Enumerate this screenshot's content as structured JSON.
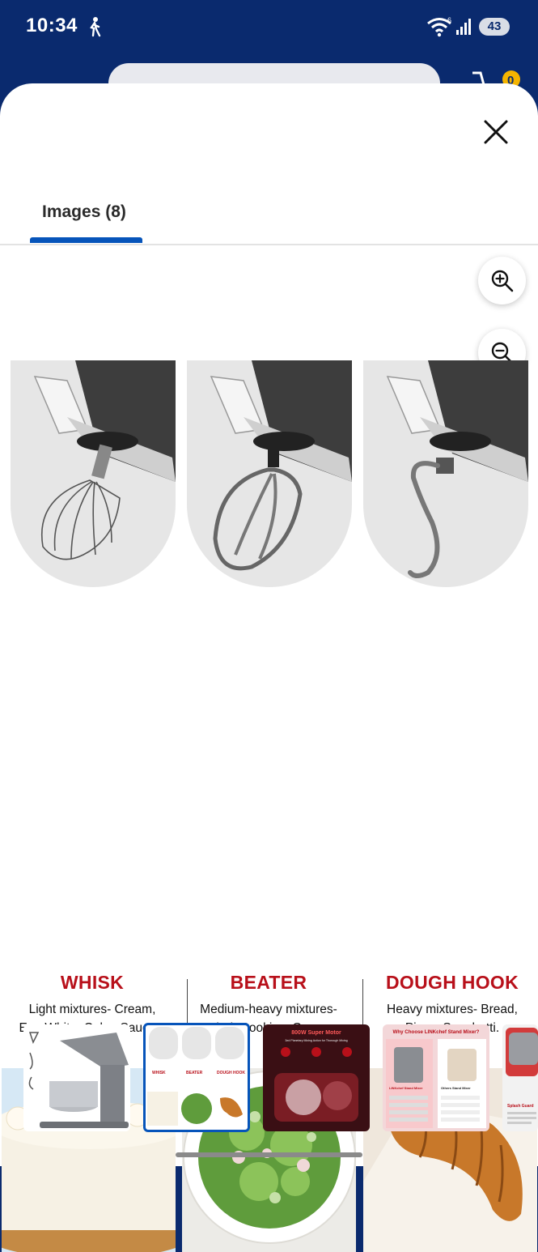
{
  "status_bar": {
    "time": "10:34",
    "battery": "43",
    "wifi_badge": "6"
  },
  "background": {
    "cart_count": "0"
  },
  "modal": {
    "tab_label": "Images (8)",
    "accent_color": "#0654ba"
  },
  "image": {
    "attachments": [
      {
        "title": "WHISK",
        "desc_line1": "Light mixtures- Cream,",
        "desc_line2": "Egg White, Cake, Sauces."
      },
      {
        "title": "BEATER",
        "desc_line1": "Medium-heavy mixtures-",
        "desc_line2": "Salad, Cookies, Crepes."
      },
      {
        "title": "DOUGH HOOK",
        "desc_line1": "Heavy mixtures- Bread,",
        "desc_line2": "Pizza, Spaghetti."
      }
    ],
    "title_color": "#b8101a"
  },
  "thumbnails": [
    {
      "name": "stand-mixer"
    },
    {
      "name": "attachments",
      "selected": true,
      "mini_labels": [
        "WHISK",
        "BEATER",
        "DOUGH HOOK"
      ]
    },
    {
      "name": "motor",
      "caption": "800W Super Motor",
      "subcaption": "3ed Planetary Mixing Action for Thorough Mixing"
    },
    {
      "name": "comparison",
      "caption": "Why Choose LINKchef Stand Mixer?",
      "left_head": "LINKchef Stand Mixer",
      "right_head": "Others Stand Mixer"
    },
    {
      "name": "splash-guard",
      "caption": "Splash Guard"
    }
  ]
}
